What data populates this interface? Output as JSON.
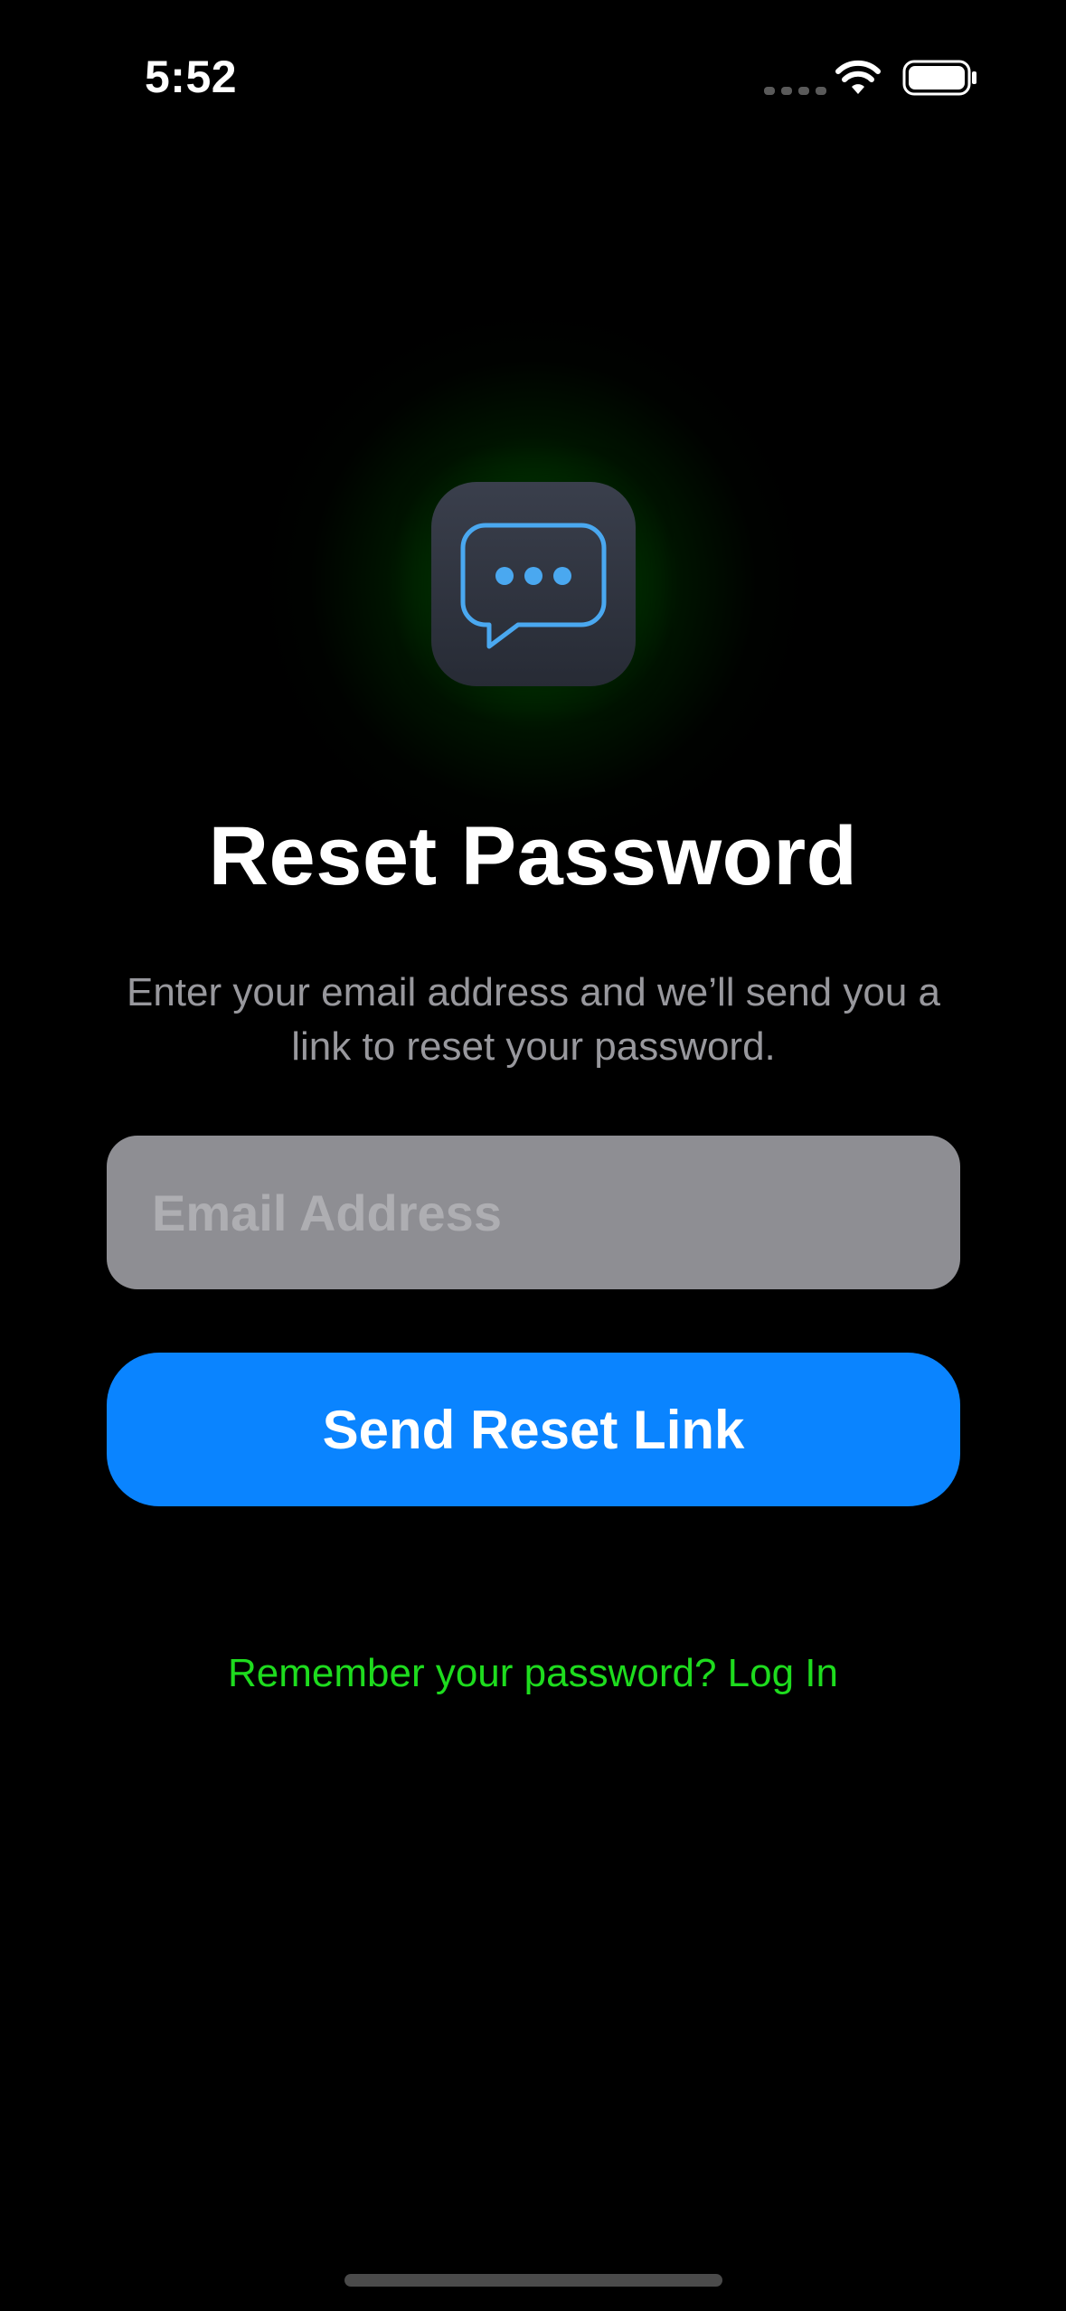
{
  "status_bar": {
    "time": "5:52",
    "wifi_icon": "wifi-icon",
    "battery_icon": "battery-icon",
    "signal_icon": "cellular-signal-icon"
  },
  "app_icon": {
    "icon": "chat-bubble-ellipsis-icon",
    "accent_color": "#4aa8f0"
  },
  "header": {
    "title": "Reset Password",
    "subtitle": "Enter your email address and we’ll send you a link to reset your password."
  },
  "form": {
    "email_placeholder": "Email Address",
    "email_value": "",
    "submit_label": "Send Reset Link"
  },
  "footer": {
    "login_link": "Remember your password? Log In"
  },
  "colors": {
    "background": "#000000",
    "primary_button": "#0a84ff",
    "link": "#1edc1e",
    "glow": "#00aa00",
    "field_background": "#8e8e93",
    "subtitle": "#98989d"
  }
}
